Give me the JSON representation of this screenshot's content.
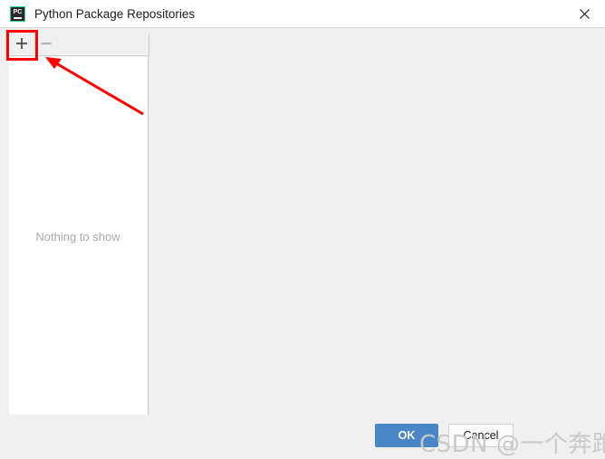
{
  "window": {
    "title": "Python Package Repositories",
    "icon_name": "pycharm-icon",
    "icon_text": "PC",
    "close_icon": "close-icon",
    "titlebar_bg": "#ffffff",
    "dialog_bg": "#f0f0f0"
  },
  "toolbar": {
    "add_label": "+",
    "add_icon": "plus-icon",
    "add_enabled": true,
    "remove_label": "−",
    "remove_icon": "minus-icon",
    "remove_enabled": false,
    "add_icon_color": "#5a5a5a",
    "remove_icon_color": "#b4b4b4"
  },
  "list": {
    "empty_message": "Nothing to show",
    "empty_message_color": "#a9a9a9",
    "items": [],
    "background": "#ffffff"
  },
  "buttons": {
    "ok_label": "OK",
    "ok_color": "#4a86c5",
    "ok_text_color": "#ffffff",
    "cancel_label": "Cancel",
    "cancel_color": "#fbfbfb"
  },
  "annotations": {
    "highlight_color": "#ff0000",
    "highlight_target": "add-button",
    "arrow_color": "#ff0000",
    "arrow_from": "158,126",
    "arrow_to": "52,64"
  },
  "watermark": {
    "text": "CSDN @一个奔跑的C",
    "color": "#c9c9c9"
  }
}
